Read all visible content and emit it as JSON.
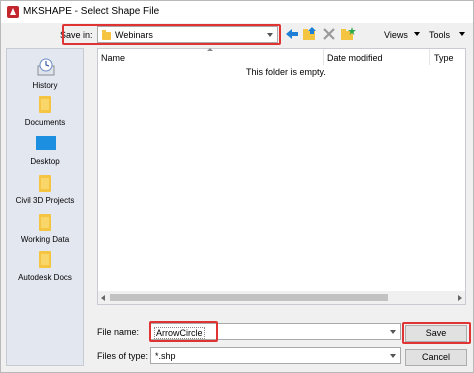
{
  "window": {
    "title": "MKSHAPE - Select Shape File"
  },
  "toolbar": {
    "save_in_label": "Save in:",
    "save_in_value": "Webinars",
    "views_label": "Views",
    "tools_label": "Tools",
    "colors": {
      "highlight": "#e03434",
      "nav_blue": "#1e7fd6",
      "folder": "#f5c542"
    }
  },
  "sidebar": {
    "items": [
      {
        "label": "History",
        "icon": "history-icon"
      },
      {
        "label": "Documents",
        "icon": "folder-icon"
      },
      {
        "label": "Desktop",
        "icon": "desktop-icon"
      },
      {
        "label": "Civil 3D Projects",
        "icon": "folder-icon"
      },
      {
        "label": "Working Data",
        "icon": "folder-icon"
      },
      {
        "label": "Autodesk Docs",
        "icon": "folder-icon"
      }
    ]
  },
  "file_list": {
    "columns": [
      "Name",
      "Date modified",
      "Type"
    ],
    "empty_message": "This folder is empty."
  },
  "footer": {
    "file_name_label": "File name:",
    "file_name_value": "ArrowCircle",
    "files_of_type_label": "Files of type:",
    "files_of_type_value": "*.shp",
    "save_button": "Save",
    "cancel_button": "Cancel"
  }
}
